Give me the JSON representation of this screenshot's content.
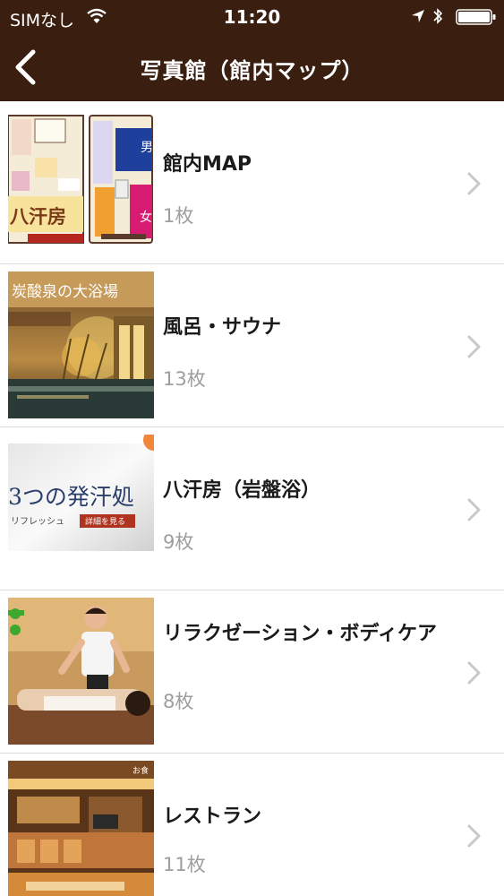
{
  "status_bar": {
    "carrier": "SIMなし",
    "time": "11:20"
  },
  "nav": {
    "title": "写真館（館内マップ）"
  },
  "albums": [
    {
      "title": "館内MAP",
      "count": "1枚",
      "thumbnail": "floor-map"
    },
    {
      "title": "風呂・サウナ",
      "count": "13枚",
      "thumbnail": "bath-garden"
    },
    {
      "title": "八汗房（岩盤浴）",
      "count": "9枚",
      "thumbnail": "sweat-banner"
    },
    {
      "title": "リラクゼーション・ボディケア",
      "count": "8枚",
      "thumbnail": "massage"
    },
    {
      "title": "レストラン",
      "count": "11枚",
      "thumbnail": "restaurant"
    }
  ],
  "thumbnail_text": {
    "map_left_sign": "八汗房",
    "map_right_men": "男",
    "map_right_women": "女",
    "bath_banner": "炭酸泉の大浴場",
    "sweat_banner": "3つの発汗処",
    "sweat_sub": "リフレッシュ",
    "sweat_button": "詳細を見る",
    "restaurant_corner": "お食"
  },
  "colors": {
    "header_bg": "#3a1f10",
    "separator": "#dcdcdc",
    "count_text": "#9e9e9e",
    "chevron": "#c7c7cc"
  }
}
